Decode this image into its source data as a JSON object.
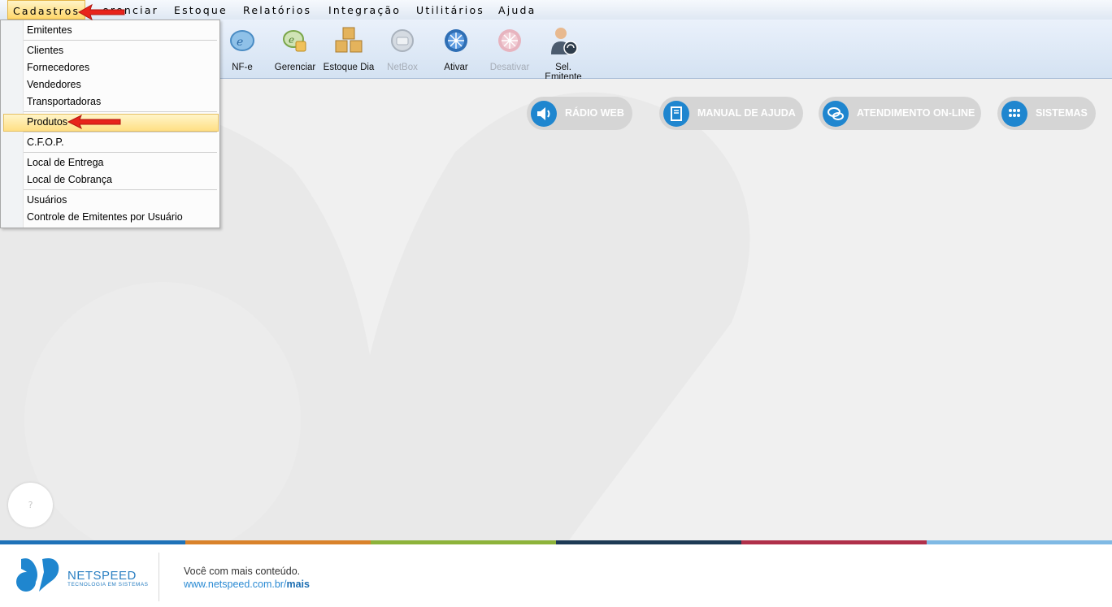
{
  "menubar": {
    "items": [
      "Cadastros",
      "Gerenciar",
      "Estoque",
      "Relatórios",
      "Integração",
      "Utilitários",
      "Ajuda"
    ],
    "visible_partial": "erenciar"
  },
  "toolbar": {
    "buttons": [
      {
        "label": "NF-e",
        "icon": "nfe-icon",
        "enabled": true
      },
      {
        "label": "Gerenciar",
        "icon": "nfe-manage-icon",
        "enabled": true
      },
      {
        "label": "Estoque Dia",
        "icon": "boxes-icon",
        "enabled": true
      },
      {
        "label": "NetBox",
        "icon": "netbox-icon",
        "enabled": false
      },
      {
        "label": "Ativar",
        "icon": "activate-icon",
        "enabled": true
      },
      {
        "label": "Desativar",
        "icon": "deactivate-icon",
        "enabled": false
      },
      {
        "label": "Sel. Emitente",
        "icon": "user-select-icon",
        "enabled": true
      }
    ]
  },
  "dropdown": {
    "items": [
      "Emitentes",
      "Clientes",
      "Fornecedores",
      "Vendedores",
      "Transportadoras",
      "Produtos",
      "C.F.O.P.",
      "Local de Entrega",
      "Local de Cobrança",
      "Usuários",
      "Controle de Emitentes por Usuário"
    ],
    "highlighted": "Produtos"
  },
  "quick_links": [
    {
      "label": "RÁDIO WEB",
      "icon": "speaker-icon"
    },
    {
      "label": "MANUAL DE AJUDA",
      "icon": "book-icon"
    },
    {
      "label": "ATENDIMENTO ON-LINE",
      "icon": "chat-icon"
    },
    {
      "label": "SISTEMAS",
      "icon": "grid-icon"
    }
  ],
  "help_bubble": "?",
  "colors": {
    "strip": [
      "#1f72b8",
      "#d9822b",
      "#8db33a",
      "#1d3a55",
      "#b0304a",
      "#7fb9e4"
    ],
    "accent": "#1f86cf"
  },
  "footer": {
    "brand": "NETSPEED",
    "brand_tagline": "TECNOLOGIA EM SISTEMAS",
    "tagline": "Você com mais conteúdo.",
    "link_prefix": "www.netspeed.com.br/",
    "link_suffix": "mais"
  }
}
